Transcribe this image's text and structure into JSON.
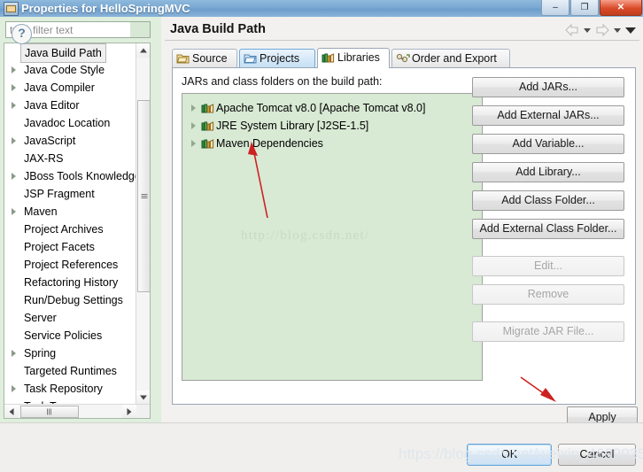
{
  "window": {
    "title": "Properties for HelloSpringMVC",
    "icon": "properties-window-icon",
    "minimize_label": "–",
    "maximize_label": "❐",
    "close_label": "✕"
  },
  "sidebar": {
    "filter": {
      "value": "",
      "placeholder": "type filter text"
    },
    "items": [
      {
        "label": "Java Build Path",
        "expandable": false,
        "selected": true
      },
      {
        "label": "Java Code Style",
        "expandable": true,
        "selected": false
      },
      {
        "label": "Java Compiler",
        "expandable": true,
        "selected": false
      },
      {
        "label": "Java Editor",
        "expandable": true,
        "selected": false
      },
      {
        "label": "Javadoc Location",
        "expandable": false,
        "selected": false
      },
      {
        "label": "JavaScript",
        "expandable": true,
        "selected": false
      },
      {
        "label": "JAX-RS",
        "expandable": false,
        "selected": false
      },
      {
        "label": "JBoss Tools Knowledge",
        "expandable": true,
        "selected": false
      },
      {
        "label": "JSP Fragment",
        "expandable": false,
        "selected": false
      },
      {
        "label": "Maven",
        "expandable": true,
        "selected": false
      },
      {
        "label": "Project Archives",
        "expandable": false,
        "selected": false
      },
      {
        "label": "Project Facets",
        "expandable": false,
        "selected": false
      },
      {
        "label": "Project References",
        "expandable": false,
        "selected": false
      },
      {
        "label": "Refactoring History",
        "expandable": false,
        "selected": false
      },
      {
        "label": "Run/Debug Settings",
        "expandable": false,
        "selected": false
      },
      {
        "label": "Server",
        "expandable": false,
        "selected": false
      },
      {
        "label": "Service Policies",
        "expandable": false,
        "selected": false
      },
      {
        "label": "Spring",
        "expandable": true,
        "selected": false
      },
      {
        "label": "Targeted Runtimes",
        "expandable": false,
        "selected": false
      },
      {
        "label": "Task Repository",
        "expandable": true,
        "selected": false
      },
      {
        "label": "Task Tags",
        "expandable": false,
        "selected": false
      }
    ]
  },
  "main": {
    "page_title": "Java Build Path",
    "nav": {
      "back_icon": "back-arrow-icon",
      "back_menu_icon": "chevron-down-icon",
      "forward_icon": "forward-arrow-icon",
      "forward_menu_icon": "chevron-down-icon",
      "menu_icon": "chevron-down-icon"
    },
    "tabs": [
      {
        "label": "Source",
        "icon": "source-folder-icon",
        "state": "normal"
      },
      {
        "label": "Projects",
        "icon": "projects-folder-icon",
        "state": "highlighted"
      },
      {
        "label": "Libraries",
        "icon": "libraries-icon",
        "state": "active"
      },
      {
        "label": "Order and Export",
        "icon": "order-export-icon",
        "state": "normal"
      }
    ],
    "libraries_tab": {
      "description": "JARs and class folders on the build path:",
      "entries": [
        {
          "label": "Apache Tomcat v8.0 [Apache Tomcat v8.0]",
          "icon": "library-icon",
          "expandable": true
        },
        {
          "label": "JRE System Library [J2SE-1.5]",
          "icon": "library-icon",
          "expandable": true
        },
        {
          "label": "Maven Dependencies",
          "icon": "library-icon",
          "expandable": true
        }
      ],
      "watermark": "http://blog.csdn.net/",
      "buttons": [
        {
          "label": "Add JARs...",
          "enabled": true
        },
        {
          "label": "Add External JARs...",
          "enabled": true
        },
        {
          "label": "Add Variable...",
          "enabled": true
        },
        {
          "label": "Add Library...",
          "enabled": true
        },
        {
          "label": "Add Class Folder...",
          "enabled": true
        },
        {
          "label": "Add External Class Folder...",
          "enabled": true
        },
        {
          "label": "Edit...",
          "enabled": false
        },
        {
          "label": "Remove",
          "enabled": false
        },
        {
          "label": "Migrate JAR File...",
          "enabled": false
        }
      ]
    },
    "apply_label": "Apply"
  },
  "footer": {
    "help_icon": "help-question-icon",
    "help_glyph": "?",
    "ok_label": "OK",
    "cancel_label": "Cancel",
    "watermark": "https://blog.csdn.net/weixin_46999356"
  },
  "annotations": [
    {
      "name": "arrow-to-maven-dependencies",
      "color": "#cc2222"
    },
    {
      "name": "arrow-to-apply-button",
      "color": "#cc2222"
    }
  ],
  "colors": {
    "titlebar": "#7aa8d2",
    "list_background": "#d8e9d4",
    "sidebar_background": "#dfeedd",
    "accent_ok": "#6aa4d6",
    "annotation": "#cc2222"
  }
}
